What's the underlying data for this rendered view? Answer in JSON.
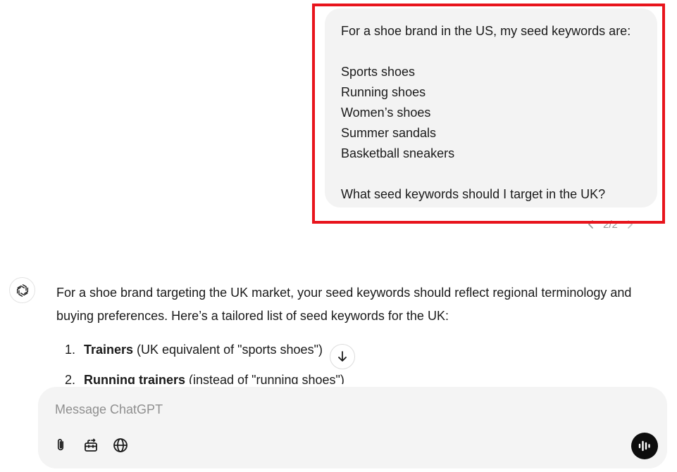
{
  "user_message": {
    "lines": [
      "For a shoe brand in the US, my seed keywords are:",
      "",
      "Sports shoes",
      "Running shoes",
      "Women’s shoes",
      "Summer sandals",
      "Basketball sneakers",
      "",
      "What seed keywords should I target in the UK?"
    ],
    "pager_text": "2/2",
    "highlight_color": "#e8141c"
  },
  "assistant": {
    "avatar_icon": "openai-logo-icon",
    "intro": "For a shoe brand targeting the UK market, your seed keywords should reflect regional terminology and buying preferences. Here’s a tailored list of seed keywords for the UK:",
    "items": [
      {
        "num": "1.",
        "bold": "Trainers",
        "rest": "(UK equivalent of \"sports shoes\")"
      },
      {
        "num": "2.",
        "bold": "Running trainers",
        "rest": "(instead of \"running shoes\")"
      }
    ]
  },
  "composer": {
    "placeholder": "Message ChatGPT",
    "tools": [
      "paperclip-icon",
      "toolbox-icon",
      "globe-icon"
    ],
    "voice_icon": "voice-waveform-icon"
  }
}
